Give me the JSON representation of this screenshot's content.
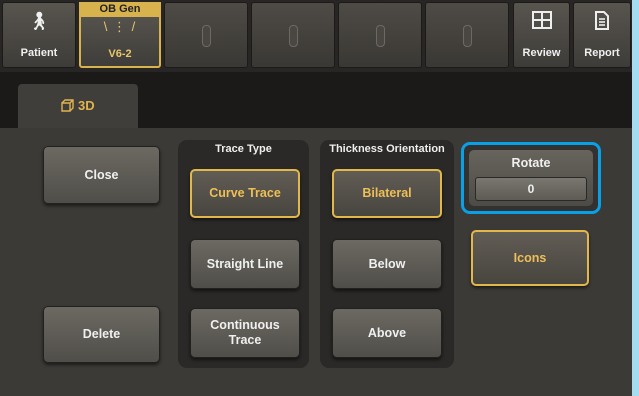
{
  "topbar": {
    "patient": {
      "label": "Patient",
      "icon": "person-icon"
    },
    "probe": {
      "title": "OB Gen",
      "label": "V6-2",
      "icon": "probe-rays-icon"
    },
    "review": {
      "label": "Review",
      "icon": "grid-icon"
    },
    "report": {
      "label": "Report",
      "icon": "document-icon"
    }
  },
  "tab": {
    "label": "3D",
    "icon": "cube-icon"
  },
  "buttons": {
    "close": "Close",
    "delete": "Delete",
    "icons": "Icons"
  },
  "trace_type": {
    "title": "Trace Type",
    "curve": "Curve Trace",
    "straight": "Straight Line",
    "continuous": "Continuous Trace"
  },
  "thickness": {
    "title": "Thickness Orientation",
    "bilateral": "Bilateral",
    "below": "Below",
    "above": "Above"
  },
  "rotate": {
    "label": "Rotate",
    "value": "0"
  },
  "colors": {
    "accent": "#e2b84b",
    "highlight": "#0aa0e6",
    "panel": "#3c3a37"
  }
}
